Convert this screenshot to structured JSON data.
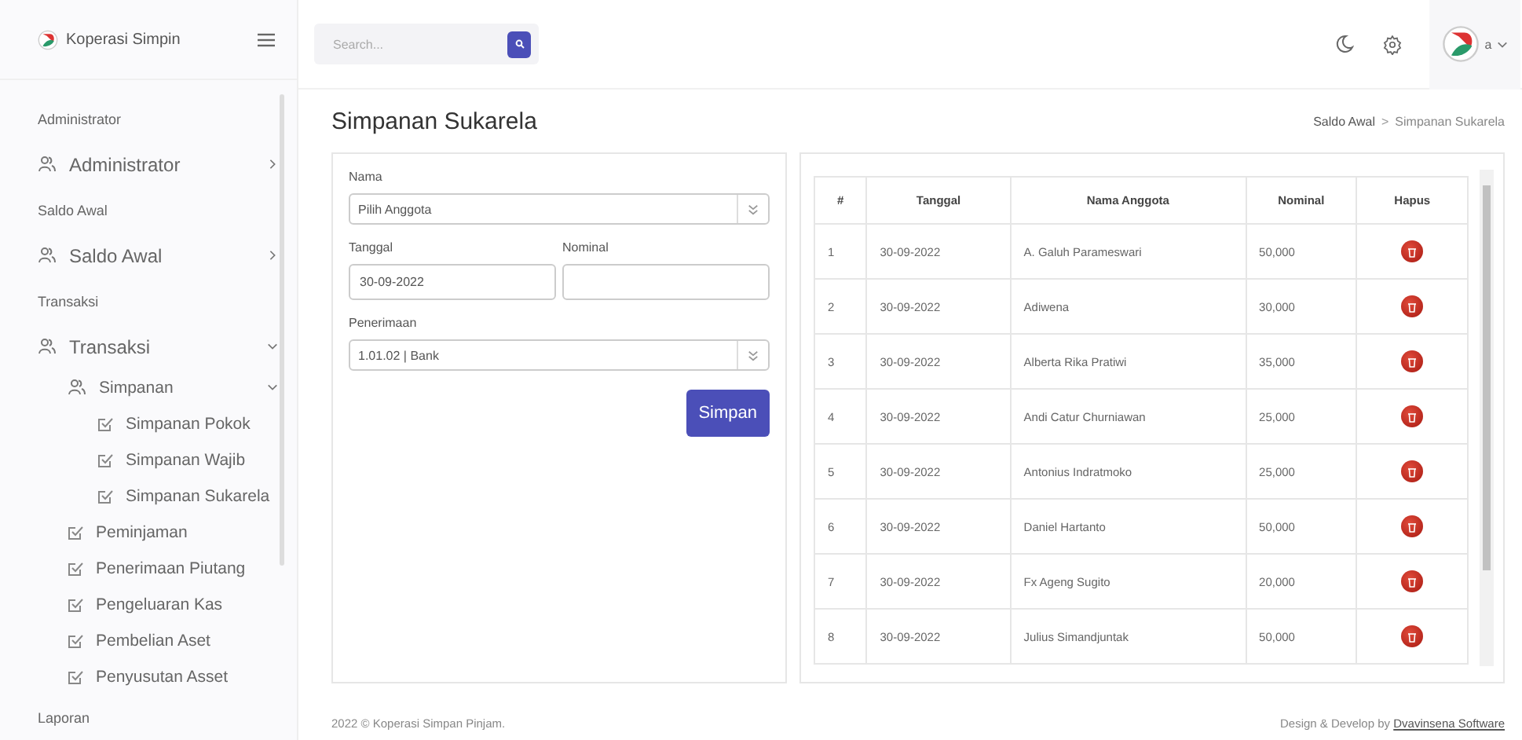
{
  "brand": {
    "name": "Koperasi Simpin"
  },
  "search": {
    "placeholder": "Search..."
  },
  "user": {
    "name": "a"
  },
  "sidebar": {
    "sections": [
      {
        "title": "Administrator",
        "items": [
          {
            "label": "Administrator",
            "kind": "group",
            "expanded": false
          }
        ]
      },
      {
        "title": "Saldo Awal",
        "items": [
          {
            "label": "Saldo Awal",
            "kind": "group",
            "expanded": false
          }
        ]
      },
      {
        "title": "Transaksi",
        "items": [
          {
            "label": "Transaksi",
            "kind": "group",
            "expanded": true,
            "children": [
              {
                "label": "Simpanan",
                "kind": "group",
                "expanded": true,
                "children": [
                  {
                    "label": "Simpanan Pokok",
                    "kind": "link"
                  },
                  {
                    "label": "Simpanan Wajib",
                    "kind": "link"
                  },
                  {
                    "label": "Simpanan Sukarela",
                    "kind": "link"
                  }
                ]
              },
              {
                "label": "Peminjaman",
                "kind": "link"
              },
              {
                "label": "Penerimaan Piutang",
                "kind": "link"
              },
              {
                "label": "Pengeluaran Kas",
                "kind": "link"
              },
              {
                "label": "Pembelian Aset",
                "kind": "link"
              },
              {
                "label": "Penyusutan Asset",
                "kind": "link"
              }
            ]
          }
        ]
      },
      {
        "title": "Laporan"
      }
    ]
  },
  "page": {
    "title": "Simpanan Sukarela",
    "breadcrumb": [
      "Saldo Awal",
      "Simpanan Sukarela"
    ],
    "breadcrumb_separator": ">"
  },
  "form": {
    "nama": {
      "label": "Nama",
      "value": "Pilih Anggota"
    },
    "tanggal": {
      "label": "Tanggal",
      "value": "30-09-2022"
    },
    "nominal": {
      "label": "Nominal"
    },
    "penerimaan": {
      "label": "Penerimaan",
      "value": "1.01.02 | Bank"
    },
    "submit": "Simpan"
  },
  "table": {
    "columns": [
      "#",
      "Tanggal",
      "Nama Anggota",
      "Nominal",
      "Hapus"
    ],
    "rows": [
      [
        "1",
        "30-09-2022",
        "A. Galuh Parameswari",
        "50,000"
      ],
      [
        "2",
        "30-09-2022",
        "Adiwena",
        "30,000"
      ],
      [
        "3",
        "30-09-2022",
        "Alberta Rika Pratiwi",
        "35,000"
      ],
      [
        "4",
        "30-09-2022",
        "Andi Catur Churniawan",
        "25,000"
      ],
      [
        "5",
        "30-09-2022",
        "Antonius Indratmoko",
        "25,000"
      ],
      [
        "6",
        "30-09-2022",
        "Daniel Hartanto",
        "50,000"
      ],
      [
        "7",
        "30-09-2022",
        "Fx Ageng Sugito",
        "20,000"
      ],
      [
        "8",
        "30-09-2022",
        "Julius Simandjuntak",
        "50,000"
      ]
    ]
  },
  "footer": {
    "copyright": "2022 © Koperasi Simpan Pinjam.",
    "credit": "Design & Develop by",
    "credit_link": "Dvavinsena Software"
  }
}
